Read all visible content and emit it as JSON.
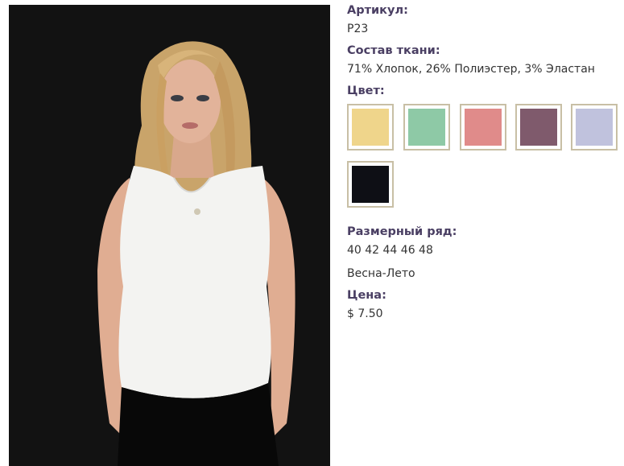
{
  "product": {
    "article_label": "Артикул:",
    "article_value": "P23",
    "fabric_label": "Состав ткани:",
    "fabric_value": "71% Хлопок, 26% Полиэстер, 3% Эластан",
    "color_label": "Цвет:",
    "colors": [
      {
        "name": "yellow",
        "hex": "#efd58b"
      },
      {
        "name": "mint",
        "hex": "#8ec9a6"
      },
      {
        "name": "pink",
        "hex": "#e08b8a"
      },
      {
        "name": "mauve",
        "hex": "#7f5a6c"
      },
      {
        "name": "lavender",
        "hex": "#c0c2dd"
      },
      {
        "name": "black",
        "hex": "#0e0f15"
      }
    ],
    "size_label": "Размерный ряд:",
    "size_value": "40 42 44 46 48",
    "season_value": "Весна-Лето",
    "price_label": "Цена:",
    "price_value": "$ 7.50"
  }
}
